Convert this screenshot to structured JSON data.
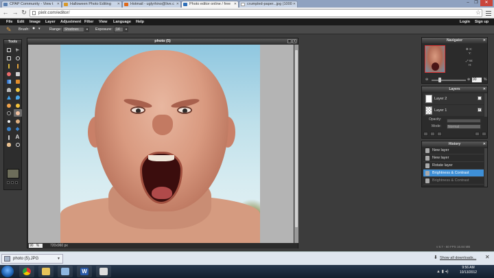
{
  "browser": {
    "tabs": [
      {
        "title": "CPAP Community - View t",
        "color": "#5a7fb0"
      },
      {
        "title": "Halloween Photo Editing",
        "color": "#d99a2b"
      },
      {
        "title": "Hotmail - uglyrhino@live.c",
        "color": "#e06a1a"
      },
      {
        "title": "Photo editor online / free",
        "color": "#2f6fb8"
      },
      {
        "title": "crumpled-paper...jpg (1000",
        "color": "#ffffff"
      }
    ],
    "url": "pixlr.com/editor/"
  },
  "menu": {
    "items": [
      "File",
      "Edit",
      "Image",
      "Layer",
      "Adjustment",
      "Filter",
      "View",
      "Language",
      "Help"
    ],
    "right": [
      "Login",
      "Sign up"
    ]
  },
  "options": {
    "brush_label": "Brush:",
    "range_label": "Range:",
    "range_value": "Shadows",
    "exposure_label": "Exposure:",
    "exposure_value": "14"
  },
  "tools": {
    "title": "Tools"
  },
  "photo_window": {
    "title": "photo (5)",
    "zoom": "90",
    "zoom_unit": "%",
    "dimensions": "720x960 px"
  },
  "navigator": {
    "title": "Navigator",
    "x_label": "X:",
    "y_label": "Y:",
    "w_label": "W:",
    "h_label": "H:",
    "zoom": "90",
    "zoom_unit": "%"
  },
  "layers": {
    "title": "Layers",
    "items": [
      {
        "name": "Layer 2",
        "checked": ""
      },
      {
        "name": "Layer 1",
        "checked": "✓"
      }
    ],
    "opacity_label": "Opacity:",
    "mode_label": "Mode:",
    "mode_value": "Normal"
  },
  "history": {
    "title": "History",
    "items": [
      "New layer",
      "New layer",
      "Rotate layer",
      "Brightness & Contrast",
      "Brightness & Contrast"
    ]
  },
  "build": "v 8.7 - 60 FPS 16.84 MB",
  "downloads": {
    "file": "photo (5).JPG",
    "show_all": "Show all downloads..."
  },
  "taskbar": {
    "time": "9:56 AM",
    "date": "10/13/2012"
  }
}
